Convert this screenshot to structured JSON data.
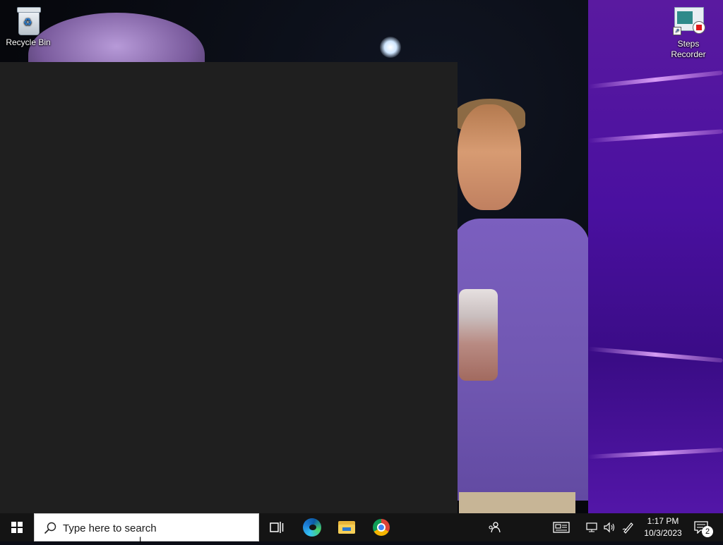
{
  "desktop": {
    "icons": [
      {
        "label": "Recycle Bin",
        "icon": "recycle-bin-icon"
      },
      {
        "label": "Steps Recorder",
        "icon": "steps-recorder-icon"
      }
    ]
  },
  "window": {
    "background": "#1f1f1f"
  },
  "taskbar": {
    "search_placeholder": "Type here to search",
    "pinned": [
      {
        "name": "Task View",
        "icon": "task-view-icon"
      },
      {
        "name": "Microsoft Edge",
        "icon": "edge-icon"
      },
      {
        "name": "File Explorer",
        "icon": "file-explorer-icon"
      },
      {
        "name": "Google Chrome",
        "icon": "chrome-icon"
      }
    ],
    "clock": {
      "time": "1:17 PM",
      "date": "10/3/2023"
    },
    "notifications_count": "2"
  }
}
